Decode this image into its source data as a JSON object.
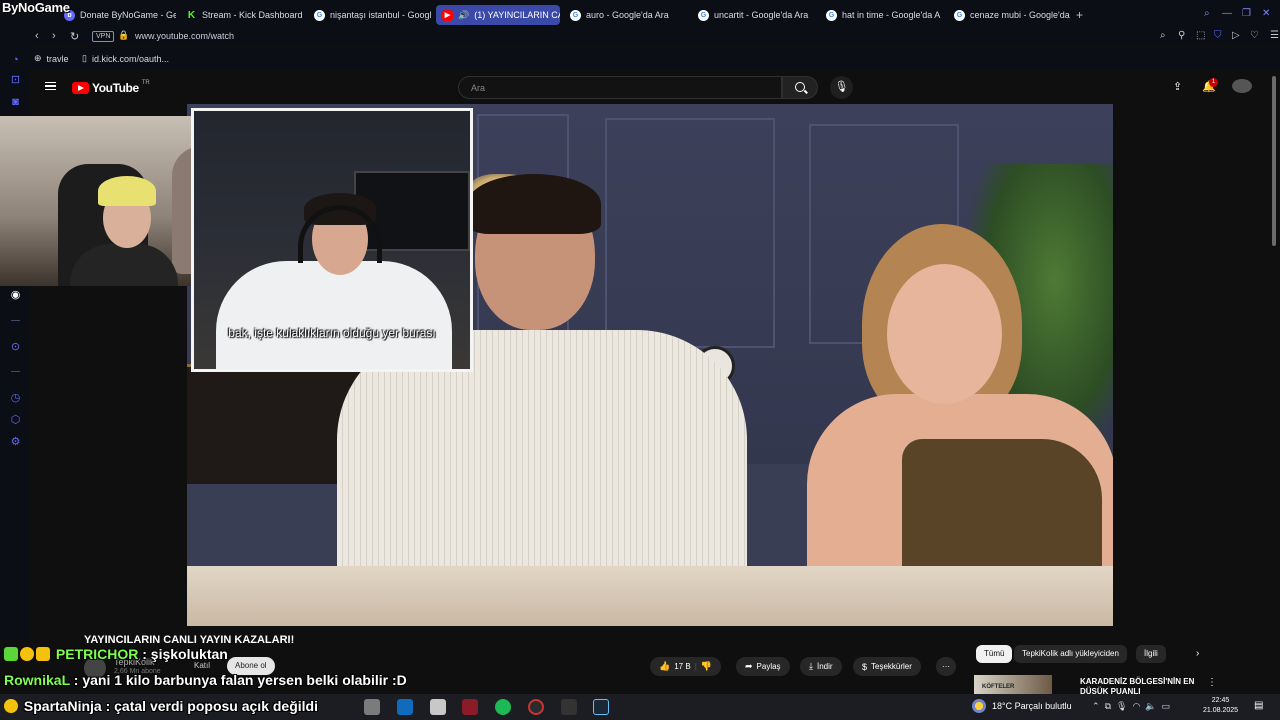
{
  "browser": {
    "brand": "ByNoGame",
    "tabs": [
      {
        "title": "Donate ByNoGame - Gei",
        "icon": "bynogame-icon"
      },
      {
        "title": "Stream - Kick Dashboard",
        "icon": "kick-icon"
      },
      {
        "title": "nişantaşı istanbul - Googl",
        "icon": "google-icon"
      },
      {
        "title": "(1) YAYINCILARIN CAN",
        "icon": "youtube-icon",
        "active": true
      },
      {
        "title": "auro - Google'da Ara",
        "icon": "google-icon"
      },
      {
        "title": "uncartit - Google'da Ara",
        "icon": "google-icon"
      },
      {
        "title": "hat in time - Google'da A",
        "icon": "google-icon"
      },
      {
        "title": "cenaze mubi - Google'da",
        "icon": "google-icon"
      }
    ],
    "new_tab": "+",
    "vpn_label": "VPN",
    "url": "www.youtube.com/watch",
    "bookmarks": [
      {
        "label": "travle",
        "icon": "globe-icon"
      },
      {
        "label": "id.kick.com/oauth...",
        "icon": "page-icon"
      }
    ]
  },
  "youtube": {
    "logo_text": "YouTube",
    "country_code": "TR",
    "search_placeholder": "Ara",
    "notification_count": "1",
    "subtitle": "bak, işte kulaklıkların olduğu yer burası",
    "video_title": "YAYINCILARIN CANLI YAYIN KAZALARI!",
    "channel_name": "TepkiKolik",
    "channel_subs": "2,66 Mn abone",
    "join_label": "Katıl",
    "subscribe_label": "Abone ol",
    "actions": {
      "likes": "17 B",
      "share": "Paylaş",
      "download": "İndir",
      "thanks": "Teşekkürler",
      "more": "···"
    },
    "chips": [
      "Tümü",
      "TepkiKolik adlı yükleyiciden",
      "İlgili"
    ],
    "recommended": {
      "thumb_text": "KÖFTELER",
      "title": "KARADENİZ BÖLGESİ'NİN EN DÜŞÜK PUANLI"
    }
  },
  "chat": [
    {
      "user": "PETRICHOR",
      "msg": " : şişkoluktan",
      "color": "#7dff4f",
      "badges": [
        "#5ad83a",
        "#f4c20d",
        "#f4c20d"
      ]
    },
    {
      "user": "RownikaL",
      "msg": " : yani 1 kilo barbunya falan yersen belki olabilir :D",
      "color": "#7dff4f",
      "badges": []
    },
    {
      "user": "SpartaNinja",
      "msg": " : çatal verdi poposu açık değildi",
      "color": "#ffffff",
      "badges": [
        "#f4c20d"
      ]
    }
  ],
  "taskbar": {
    "weather": "18°C  Parçalı bulutlu",
    "time": "22:45",
    "date": "21.08.2025"
  }
}
